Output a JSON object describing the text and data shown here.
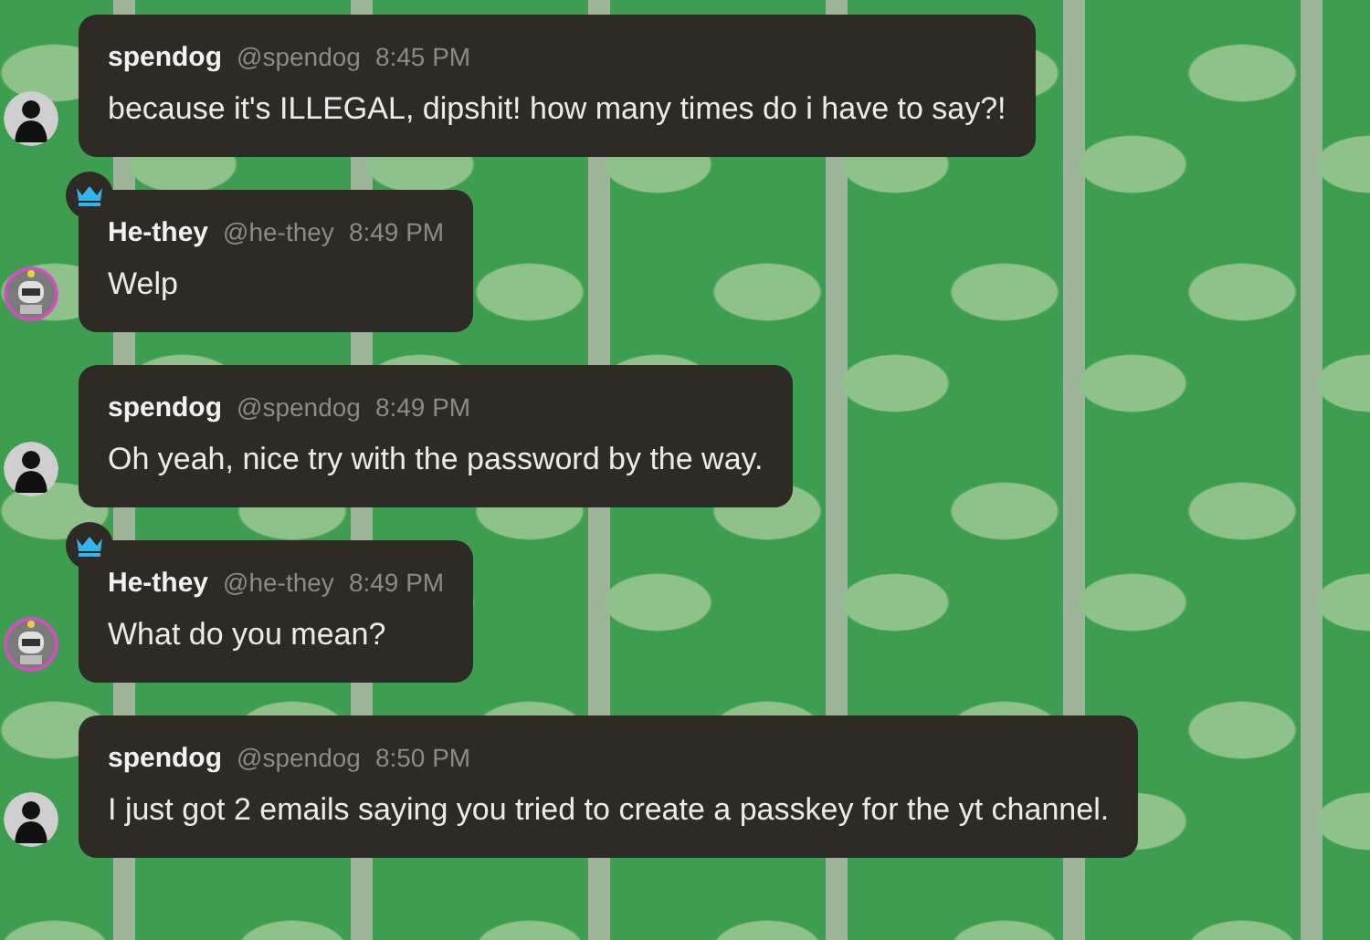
{
  "messages": [
    {
      "name": "spendog",
      "handle": "@spendog",
      "time": "8:45 PM",
      "text": "because it's ILLEGAL, dipshit! how many times do i have to say?!",
      "kind": "silhouette",
      "crowned": false
    },
    {
      "name": "He-they",
      "handle": "@he-they",
      "time": "8:49 PM",
      "text": "Welp",
      "kind": "robot",
      "crowned": true
    },
    {
      "name": "spendog",
      "handle": "@spendog",
      "time": "8:49 PM",
      "text": "Oh yeah, nice try with the password by the way.",
      "kind": "silhouette",
      "crowned": false
    },
    {
      "name": "He-they",
      "handle": "@he-they",
      "time": "8:49 PM",
      "text": "What do you mean?",
      "kind": "robot",
      "crowned": true
    },
    {
      "name": "spendog",
      "handle": "@spendog",
      "time": "8:50 PM",
      "text": "I just got 2 emails saying you tried to create a passkey for the yt channel.",
      "kind": "silhouette",
      "crowned": false
    }
  ]
}
